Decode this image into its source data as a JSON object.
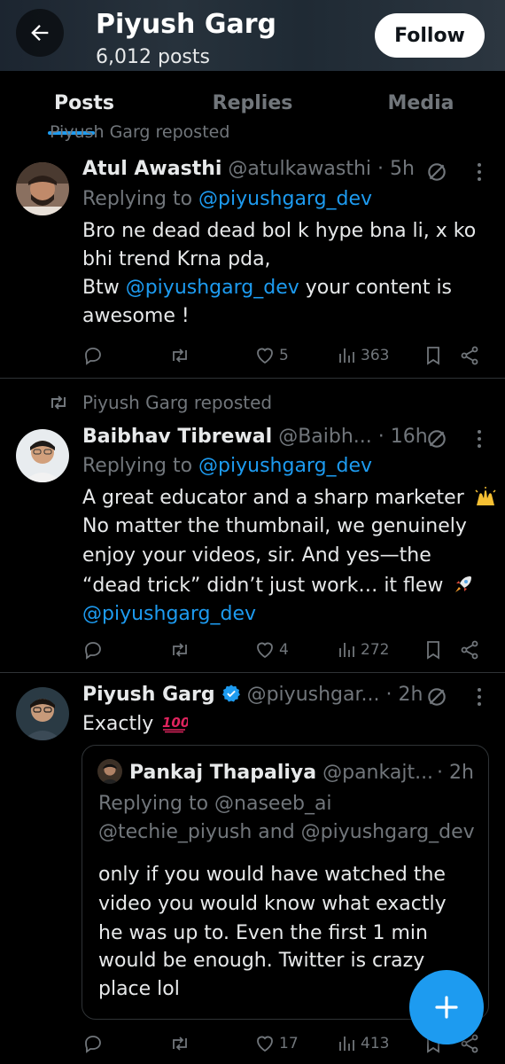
{
  "header": {
    "profile_name": "Piyush Garg",
    "post_count": "6,012 posts",
    "follow_label": "Follow"
  },
  "tabs": [
    {
      "label": "Posts",
      "active": true
    },
    {
      "label": "Replies",
      "active": false
    },
    {
      "label": "Media",
      "active": false
    }
  ],
  "clipped_repost": "Piyush Garg reposted",
  "posts": [
    {
      "name": "Atul Awasthi",
      "handle": "@atulkawasthi",
      "time": "· 5h",
      "replying_prefix": "Replying to",
      "replying_to": "@piyushgarg_dev",
      "text_line1": "Bro ne dead dead bol k hype bna li, x ko",
      "text_line2": "bhi trend Krna pda,",
      "text_line3_prefix": "Btw",
      "text_line3_mention": "@piyushgarg_dev",
      "text_line3_suffix": "your content is",
      "text_line4": "awesome !",
      "likes": "5",
      "views": "363"
    },
    {
      "repost_label": "Piyush Garg reposted",
      "name": "Baibhav Tibrewal",
      "handle": "@Baibh...",
      "time": "· 16h",
      "replying_prefix": "Replying to",
      "replying_to": "@piyushgarg_dev",
      "text_line1": "A great educator and a sharp marketer",
      "text_line2": "No matter the thumbnail, we genuinely",
      "text_line3": "enjoy your videos, sir. And yes—the",
      "text_line4": "“dead trick” didn’t just work… it flew",
      "text_line5_mention": "@piyushgarg_dev",
      "likes": "4",
      "views": "272"
    },
    {
      "name": "Piyush Garg",
      "handle": "@piyushgar...",
      "time": "· 2h",
      "text": "Exactly",
      "quote": {
        "name": "Pankaj Thapaliya",
        "handle": "@pankajt...",
        "time": "· 2h",
        "replying_line1": "Replying to @naseeb_ai",
        "replying_line2": "@techie_piyush and @piyushgarg_dev",
        "text_line1": "only if you would have watched the",
        "text_line2": "video you would know what exactly",
        "text_line3": "he was up to. Even the first 1 min",
        "text_line4": "would be enough. Twitter is crazy",
        "text_line5": "place lol"
      },
      "likes": "17",
      "views": "413"
    }
  ],
  "icons": {
    "back": "back-arrow-icon",
    "grok": "grok-icon",
    "more": "more-vertical-icon",
    "reply": "reply-icon",
    "repost": "repost-icon",
    "like": "heart-icon",
    "views": "views-icon",
    "bookmark": "bookmark-icon",
    "share": "share-icon",
    "compose": "plus-icon",
    "verified": "verified-badge-icon",
    "emoji_raised_hands": "raised-hands-icon",
    "emoji_rocket": "rocket-icon",
    "emoji_hundred": "hundred-points-icon"
  },
  "colors": {
    "accent": "#1d9bf0",
    "background": "#000000",
    "muted": "#71767b",
    "divider": "#2f3336"
  }
}
